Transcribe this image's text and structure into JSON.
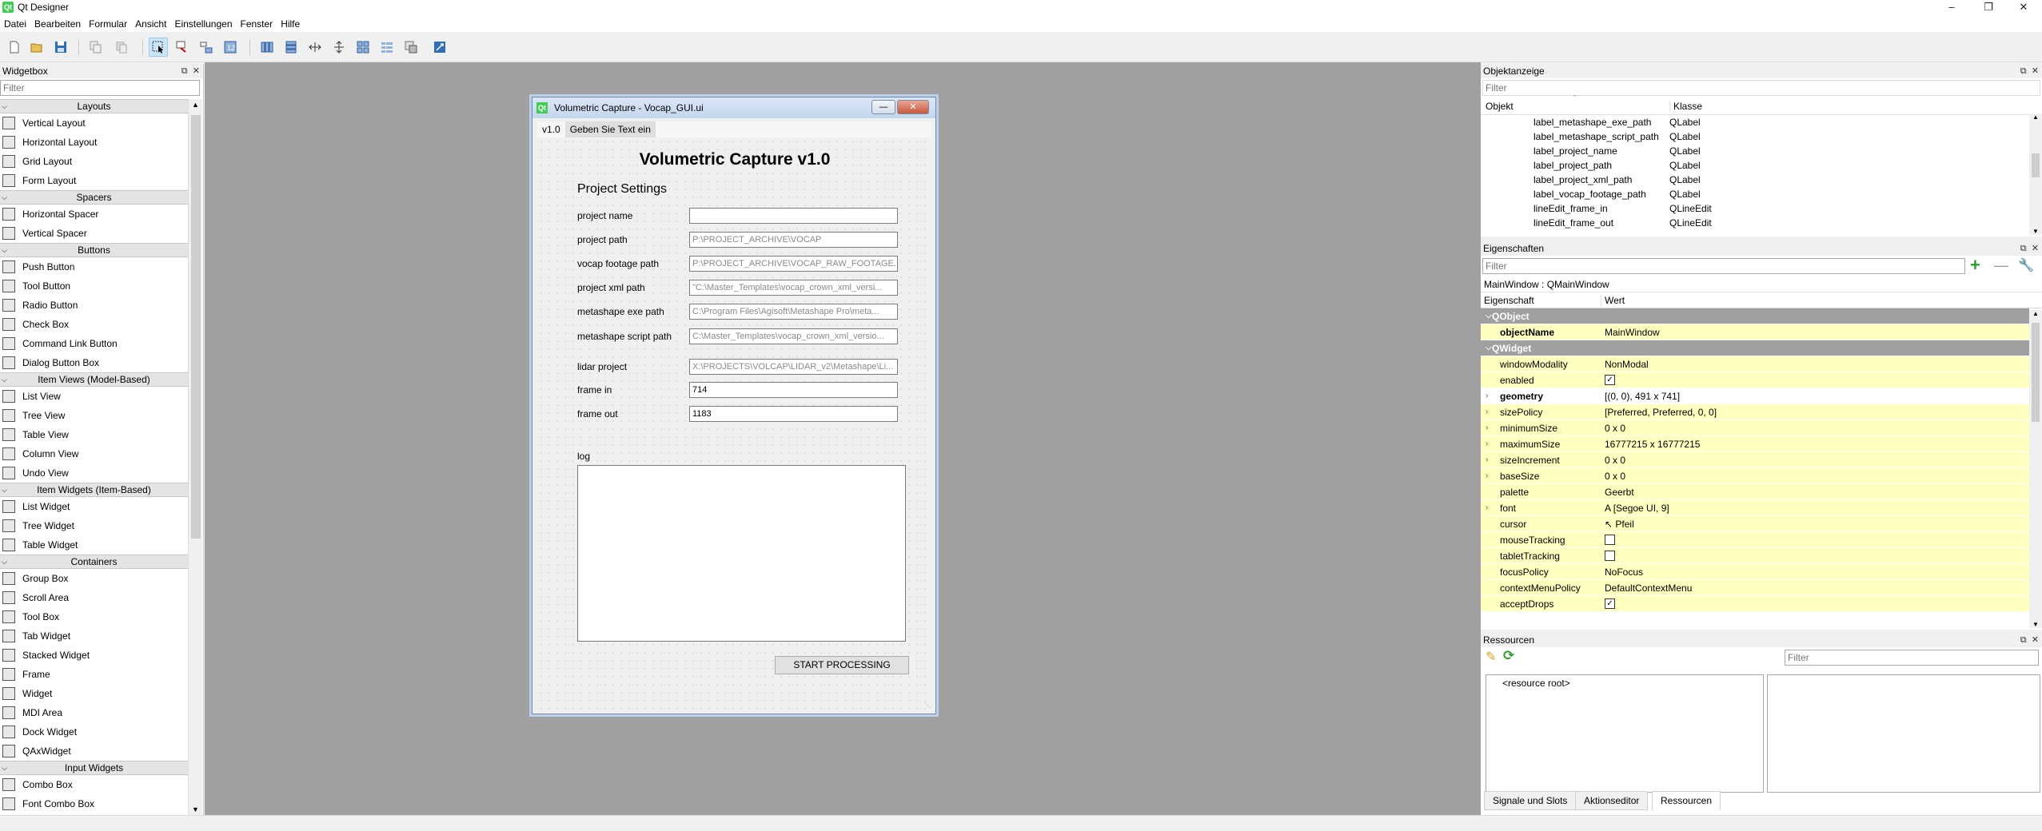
{
  "app": {
    "title": "Qt Designer",
    "icon_text": "Qt"
  },
  "menubar": [
    "Datei",
    "Bearbeiten",
    "Formular",
    "Ansicht",
    "Einstellungen",
    "Fenster",
    "Hilfe"
  ],
  "widgetbox": {
    "title": "Widgetbox",
    "filter_placeholder": "Filter",
    "categories": [
      {
        "label": "Layouts",
        "items": [
          "Vertical Layout",
          "Horizontal Layout",
          "Grid Layout",
          "Form Layout"
        ]
      },
      {
        "label": "Spacers",
        "items": [
          "Horizontal Spacer",
          "Vertical Spacer"
        ]
      },
      {
        "label": "Buttons",
        "items": [
          "Push Button",
          "Tool Button",
          "Radio Button",
          "Check Box",
          "Command Link Button",
          "Dialog Button Box"
        ]
      },
      {
        "label": "Item Views (Model-Based)",
        "items": [
          "List View",
          "Tree View",
          "Table View",
          "Column View",
          "Undo View"
        ]
      },
      {
        "label": "Item Widgets (Item-Based)",
        "items": [
          "List Widget",
          "Tree Widget",
          "Table Widget"
        ]
      },
      {
        "label": "Containers",
        "items": [
          "Group Box",
          "Scroll Area",
          "Tool Box",
          "Tab Widget",
          "Stacked Widget",
          "Frame",
          "Widget",
          "MDI Area",
          "Dock Widget",
          "QAxWidget"
        ]
      },
      {
        "label": "Input Widgets",
        "items": [
          "Combo Box",
          "Font Combo Box"
        ]
      }
    ]
  },
  "form_window": {
    "title": "Volumetric Capture - Vocap_GUI.ui",
    "menu": [
      "v1.0",
      "Geben Sie Text ein"
    ],
    "heading": "Volumetric Capture v1.0",
    "section": "Project Settings",
    "fields": {
      "project_name": {
        "label": "project name",
        "value": ""
      },
      "project_path": {
        "label": "project path",
        "placeholder": "P:\\PROJECT_ARCHIVE\\VOCAP"
      },
      "vocap_footage_path": {
        "label": "vocap footage path",
        "placeholder": "P:\\PROJECT_ARCHIVE\\VOCAP_RAW_FOOTAGE..."
      },
      "project_xml_path": {
        "label": "project xml path",
        "placeholder": "\"C:\\Master_Templates\\vocap_crown_xml_versi..."
      },
      "metashape_exe_path": {
        "label": "metashape exe path",
        "placeholder": "C:\\Program Files\\Agisoft\\Metashape Pro\\meta..."
      },
      "metashape_script_path": {
        "label": "metashape script path",
        "placeholder": "C:\\Master_Templates\\vocap_crown_xml_versio..."
      },
      "lidar_project": {
        "label": "lidar project",
        "placeholder": "X:\\PROJECTS\\VOLCAP\\LIDAR_v2\\Metashape\\Li..."
      },
      "frame_in": {
        "label": "frame in",
        "value": "714"
      },
      "frame_out": {
        "label": "frame out",
        "value": "1183"
      }
    },
    "log_label": "log",
    "start_button": "START PROCESSING"
  },
  "object_inspector": {
    "title": "Objektanzeige",
    "filter_placeholder": "Filter",
    "columns": [
      "Objekt",
      "Klasse"
    ],
    "rows": [
      {
        "object": "label_metashape_exe_path",
        "class": "QLabel"
      },
      {
        "object": "label_metashape_script_path",
        "class": "QLabel"
      },
      {
        "object": "label_project_name",
        "class": "QLabel"
      },
      {
        "object": "label_project_path",
        "class": "QLabel"
      },
      {
        "object": "label_project_xml_path",
        "class": "QLabel"
      },
      {
        "object": "label_vocap_footage_path",
        "class": "QLabel"
      },
      {
        "object": "lineEdit_frame_in",
        "class": "QLineEdit"
      },
      {
        "object": "lineEdit_frame_out",
        "class": "QLineEdit"
      }
    ]
  },
  "property_editor": {
    "title": "Eigenschaften",
    "filter_placeholder": "Filter",
    "context": "MainWindow : QMainWindow",
    "columns": [
      "Eigenschaft",
      "Wert"
    ],
    "rows": [
      {
        "kind": "class",
        "name": "QObject"
      },
      {
        "kind": "prop",
        "name": "objectName",
        "value": "MainWindow",
        "bold": true,
        "yellow": true
      },
      {
        "kind": "class",
        "name": "QWidget"
      },
      {
        "kind": "prop",
        "name": "windowModality",
        "value": "NonModal",
        "yellow": true
      },
      {
        "kind": "prop",
        "name": "enabled",
        "check": true,
        "yellow": true
      },
      {
        "kind": "prop",
        "name": "geometry",
        "value": "[(0, 0), 491 x 741]",
        "bold": true,
        "expand": true
      },
      {
        "kind": "prop",
        "name": "sizePolicy",
        "value": "[Preferred, Preferred, 0, 0]",
        "expand": true,
        "yellow": true
      },
      {
        "kind": "prop",
        "name": "minimumSize",
        "value": "0 x 0",
        "expand": true,
        "yellow": true
      },
      {
        "kind": "prop",
        "name": "maximumSize",
        "value": "16777215 x 16777215",
        "expand": true,
        "yellow": true
      },
      {
        "kind": "prop",
        "name": "sizeIncrement",
        "value": "0 x 0",
        "expand": true,
        "yellow": true
      },
      {
        "kind": "prop",
        "name": "baseSize",
        "value": "0 x 0",
        "expand": true,
        "yellow": true
      },
      {
        "kind": "prop",
        "name": "palette",
        "value": "Geerbt",
        "yellow": true
      },
      {
        "kind": "prop",
        "name": "font",
        "value": "[Segoe UI, 9]",
        "glyph": "A",
        "expand": true,
        "yellow": true
      },
      {
        "kind": "prop",
        "name": "cursor",
        "value": "Pfeil",
        "glyph": "↖",
        "yellow": true
      },
      {
        "kind": "prop",
        "name": "mouseTracking",
        "check": false,
        "yellow": true
      },
      {
        "kind": "prop",
        "name": "tabletTracking",
        "check": false,
        "yellow": true
      },
      {
        "kind": "prop",
        "name": "focusPolicy",
        "value": "NoFocus",
        "yellow": true
      },
      {
        "kind": "prop",
        "name": "contextMenuPolicy",
        "value": "DefaultContextMenu",
        "yellow": true
      },
      {
        "kind": "prop",
        "name": "acceptDrops",
        "check": true,
        "yellow": true
      }
    ]
  },
  "resources": {
    "title": "Ressourcen",
    "filter_placeholder": "Filter",
    "root": "<resource root>"
  },
  "bottom_tabs": [
    "Signale und Slots",
    "Aktionseditor",
    "Ressourcen"
  ],
  "colors": {
    "mdi_background": "#a0a0a0",
    "qt_green": "#41cd52",
    "property_changed": "#ffffbf",
    "class_header": "#a0a0a0"
  }
}
